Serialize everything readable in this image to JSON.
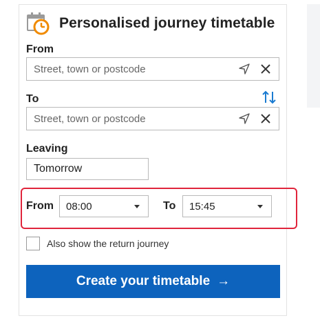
{
  "header": {
    "title": "Personalised journey timetable",
    "icon": "calendar-clock-icon"
  },
  "from": {
    "label": "From",
    "placeholder": "Street, town or postcode",
    "value": ""
  },
  "to": {
    "label": "To",
    "placeholder": "Street, town or postcode",
    "value": ""
  },
  "leaving": {
    "label": "Leaving",
    "value": "Tomorrow"
  },
  "time_range": {
    "from_label": "From",
    "from_value": "08:00",
    "to_label": "To",
    "to_value": "15:45"
  },
  "return_journey": {
    "label": "Also show the return journey",
    "checked": false
  },
  "cta": {
    "label": "Create your timetable",
    "arrow": "→"
  },
  "colors": {
    "accent": "#0d63bd",
    "highlight": "#e0243b",
    "icon_orange": "#f08a00"
  }
}
